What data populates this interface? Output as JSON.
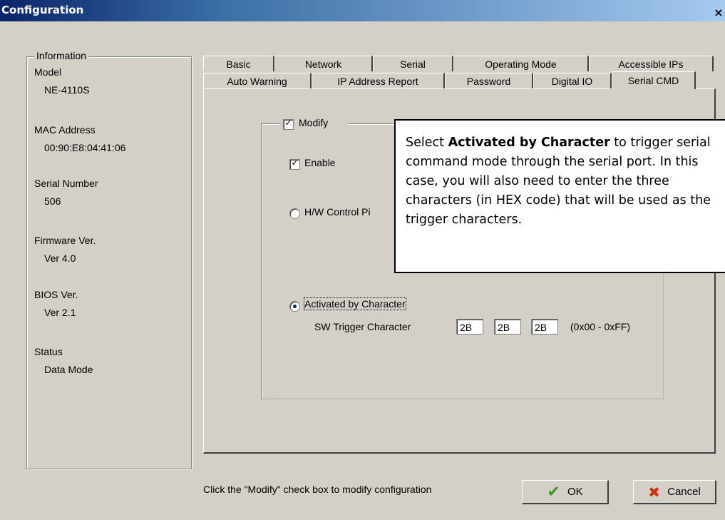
{
  "window": {
    "title": "Configuration",
    "close_glyph": "×"
  },
  "info": {
    "group_title": "Information",
    "model_label": "Model",
    "model_value": "NE-4110S",
    "mac_label": "MAC Address",
    "mac_value": "00:90:E8:04:41:06",
    "serial_label": "Serial Number",
    "serial_value": "506",
    "firmware_label": "Firmware Ver.",
    "firmware_value": "Ver 4.0",
    "bios_label": "BIOS Ver.",
    "bios_value": "Ver 2.1",
    "status_label": "Status",
    "status_value": "Data Mode"
  },
  "tabs": {
    "row1": [
      "Basic",
      "Network",
      "Serial",
      "Operating Mode",
      "Accessible IPs"
    ],
    "row2": [
      "Auto Warning",
      "IP Address Report",
      "Password",
      "Digital IO",
      "Serial CMD"
    ],
    "active": "Serial CMD"
  },
  "serial_cmd": {
    "modify_label": "Modify",
    "modify_checked": true,
    "enable_label": "Enable",
    "enable_checked": true,
    "hw_label": "H/W Control Pi",
    "activated_label": "Activated by Character",
    "sw_trigger_label": "SW Trigger Character",
    "trigger_values": [
      "2B",
      "2B",
      "2B"
    ],
    "range_hint": "(0x00 - 0xFF)"
  },
  "callout": {
    "before": "Select ",
    "bold": "Activated by Character",
    "after": " to trigger serial command mode through the serial port. In this case, you will also need to enter the three characters (in HEX code) that will be used as the trigger characters."
  },
  "footer": {
    "hint": "Click the \"Modify\" check box to modify configuration",
    "ok_label": "OK",
    "cancel_label": "Cancel"
  },
  "colors": {
    "window_bg": "#d4d0c8",
    "title_bar": "#0a246a",
    "ok_icon": "#3c9a1e",
    "cancel_icon": "#d03010"
  }
}
